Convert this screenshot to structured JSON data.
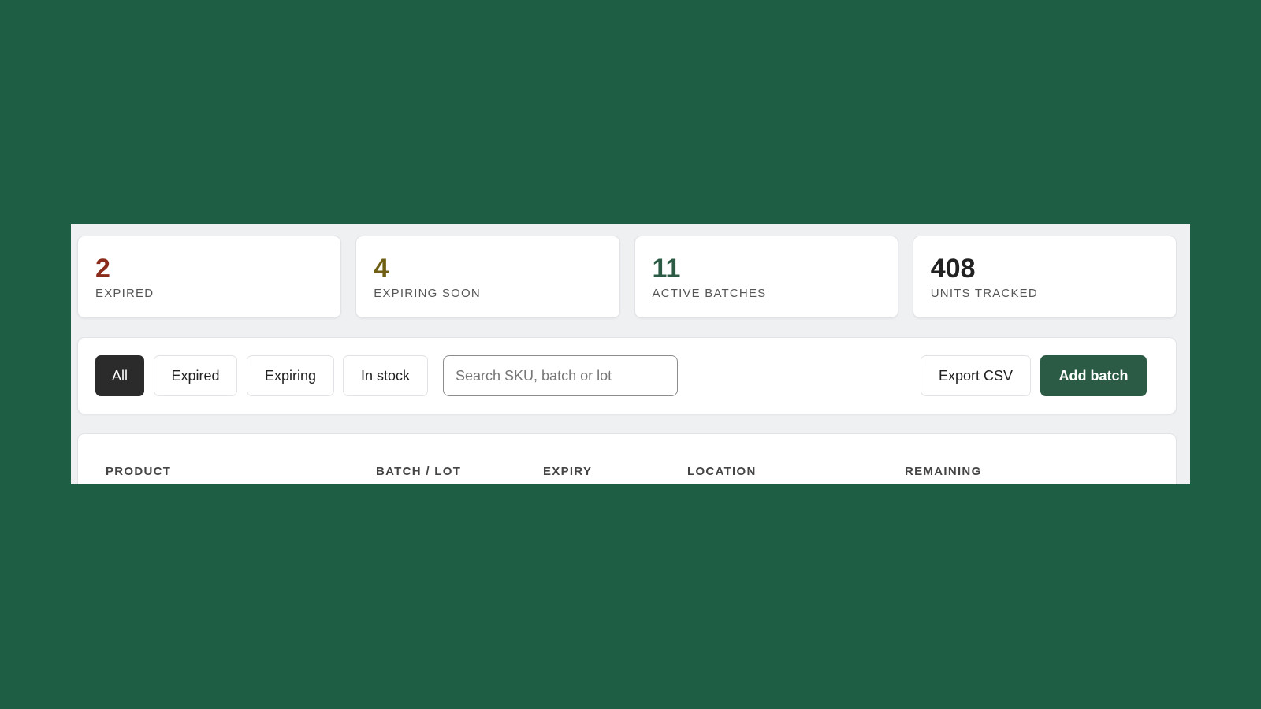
{
  "stats": [
    {
      "value": "2",
      "label": "EXPIRED",
      "color": "#8a2b1c"
    },
    {
      "value": "4",
      "label": "EXPIRING SOON",
      "color": "#6e5f12"
    },
    {
      "value": "11",
      "label": "ACTIVE BATCHES",
      "color": "#2b5b44"
    },
    {
      "value": "408",
      "label": "UNITS TRACKED",
      "color": "#222222"
    }
  ],
  "filters": {
    "all": "All",
    "expired": "Expired",
    "expiring": "Expiring",
    "in_stock": "In stock",
    "active": "All"
  },
  "search": {
    "placeholder": "Search SKU, batch or lot",
    "value": ""
  },
  "actions": {
    "export": "Export CSV",
    "add": "Add batch"
  },
  "table": {
    "columns": [
      "PRODUCT",
      "BATCH / LOT",
      "EXPIRY",
      "LOCATION",
      "REMAINING"
    ]
  },
  "colors": {
    "brand": "#2b5b44",
    "background": "#1d5e45",
    "active_chip": "#2b2b2b"
  }
}
